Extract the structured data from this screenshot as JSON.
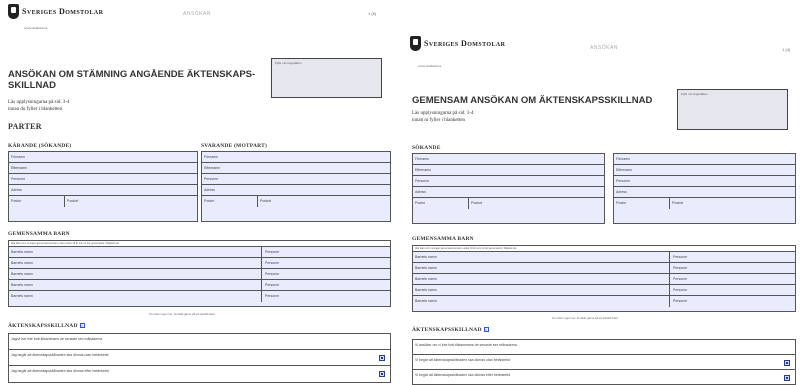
{
  "left": {
    "brand": "Sveriges Domstolar",
    "site": "www.domstol.se",
    "form_type": "ANSÖKAN",
    "page": "1 (6)",
    "title_line1": "ANSÖKAN OM STÄMNING ANGÅENDE ÄKTENSKAPS-",
    "title_line2": "SKILLNAD",
    "reg_label": "Fylls i av tingsrätten",
    "intro_line1": "Läs upplysningarna på sid. 3-4",
    "intro_line2": "innan du fyller i blanketten",
    "parties_heading": "PARTER",
    "plaintiff_heading": "KÄRANDE (SÖKANDE)",
    "defendant_heading": "SVARANDE (MOTPART)",
    "fields": [
      "Förnamn",
      "Efternamn",
      "Personnr",
      "Adress"
    ],
    "postnr": "Postnr",
    "postort": "Postort",
    "children_heading": "GEMENSAMMA BARN",
    "children_hint": "Alla barn som ni anger gemensamma barn, barn under 18 år som ni bor gemensamt i följande län",
    "child_name": "Barnets namn",
    "child_pnr": "Personnr",
    "children_note": "Om barn inget mer. Fortsätt gärna på ett särskilt blad",
    "divorce_heading": "ÄKTENSKAPSSKILLNAD",
    "mark_header": "Kryss",
    "options": [
      "Jag/vi har inte bott tillsammans de senaste sex månaderna",
      "Jag begär att äktenskapsskillnaden ska dömas utan betänketid",
      "Jag begär att äktenskapsskillnaden ska dömas efter betänketid"
    ]
  },
  "right": {
    "brand": "Sveriges Domstolar",
    "site": "www.domstol.se",
    "form_type": "ANSÖKAN",
    "page": "1 (4)",
    "title": "GEMENSAM ANSÖKAN OM ÄKTENSKAPSSKILLNAD",
    "reg_label": "Fylls i av tingsrätten",
    "intro_line1": "Läs upplysningarna på sid. 3-4",
    "intro_line2": "innan ni fyller i blanketten",
    "applicants_heading": "SÖKANDE",
    "fields": [
      "Förnamn",
      "Efternamn",
      "Personnr",
      "Adress"
    ],
    "postnr": "Postnr",
    "postort": "Postort",
    "children_heading": "GEMENSAMMA BARN",
    "children_hint": "Alla barn som ni anger gemensamma barn under 18 år som ni bor gemensamt i följande län",
    "child_name": "Barnets namn",
    "child_pnr": "Personnr",
    "children_note": "Om barn inget mer. Fortsätt gärna på ett särskilt blad",
    "divorce_heading": "ÄKTENSKAPSSKILLNAD",
    "mark_header": "Kryss",
    "options": [
      "Vi ansöker om vi inte bott tillsammans de senaste sex månaderna",
      "Vi begär att äktenskapsskillnaden ska dömas utan betänketid",
      "Vi begär att äktenskapsskillnaden ska dömas efter betänketid"
    ]
  }
}
